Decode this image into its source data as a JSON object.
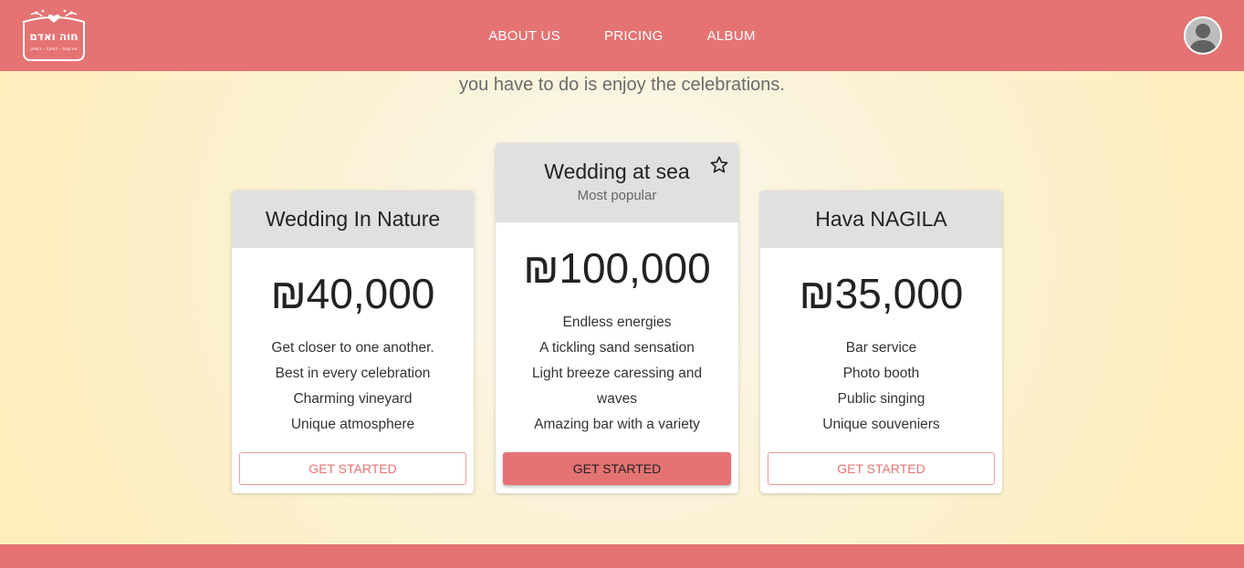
{
  "brand": {
    "logo_text": "חוה ואדם",
    "logo_subtext": "אירועים - הפקה - בוטיק",
    "icon": "hearts-wreath-logo"
  },
  "nav": {
    "items": [
      {
        "label": "ABOUT US"
      },
      {
        "label": "PRICING"
      },
      {
        "label": "ALBUM"
      }
    ],
    "avatar_icon": "user-avatar-icon"
  },
  "intro": {
    "text": "you have to do is enjoy the celebrations."
  },
  "plans": [
    {
      "title": "Wedding In Nature",
      "price": "₪40,000",
      "features": [
        "Get closer to one another.",
        "Best in every celebration",
        "Charming vineyard",
        "Unique atmosphere"
      ],
      "button": "GET STARTED"
    },
    {
      "title": "Wedding at sea",
      "subtitle": "Most popular",
      "price": "₪100,000",
      "features": [
        "Endless energies",
        "A tickling sand sensation",
        "Light breeze caressing and waves",
        "Amazing bar with a variety"
      ],
      "button": "GET STARTED",
      "icon": "star-outline-icon"
    },
    {
      "title": "Hava NAGILA",
      "price": "₪35,000",
      "features": [
        "Bar service",
        "Photo booth",
        "Public singing",
        "Unique souveniers"
      ],
      "button": "GET STARTED"
    }
  ],
  "colors": {
    "primary": "#e57373",
    "header_gray": "#e0e0e0",
    "background_warm": "#ffedb5"
  }
}
